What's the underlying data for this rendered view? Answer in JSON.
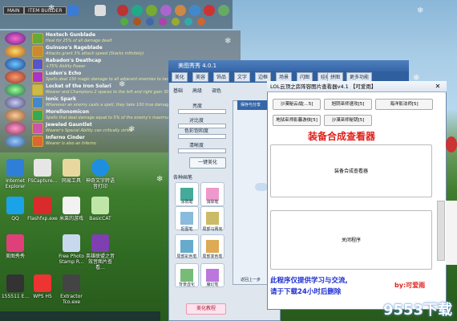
{
  "topbar": {
    "tab_main": "MAIN",
    "tab_builder": "ITEM BUILDER"
  },
  "items": [
    {
      "name": "Hextech Gunblade",
      "desc": "Heal for 25% of all damage dealt"
    },
    {
      "name": "Guinsoo's Rageblade",
      "desc": "Attacks grant 3% attack speed (Stacks infinitely)"
    },
    {
      "name": "Rabadon's Deathcap",
      "desc": "+75% Ability Power"
    },
    {
      "name": "Luden's Echo",
      "desc": "Spells deal 150 magic damage to all adjacent enemies to target"
    },
    {
      "name": "Locket of the Iron Solari",
      "desc": "Wearer and Champions 2 spaces to the left and right gain 300 shield on round start for 8 seconds"
    },
    {
      "name": "Ionic Spark",
      "desc": "Whenever an enemy casts a spell, they take 100 true damage"
    },
    {
      "name": "Morellonomicon",
      "desc": "Spells that deal damage equal to 5% of the enemy's maximum health per second and reduce healing by 80%"
    },
    {
      "name": "Jeweled Gauntlet",
      "desc": "Wearer's Special Ability can critically strike"
    },
    {
      "name": "Inferno Cinder",
      "desc": "Wearer is also an Inferno"
    }
  ],
  "desktop": [
    {
      "label": "Internet Explorer"
    },
    {
      "label": "FSCapture..."
    },
    {
      "label": "网易工具"
    },
    {
      "label": "神奇文字转语音打印"
    },
    {
      "label": "QQ"
    },
    {
      "label": "Flashfxp.exe"
    },
    {
      "label": "米莱的游戏"
    },
    {
      "label": "BasicCAT"
    },
    {
      "label": "美图秀秀"
    },
    {
      "label": "Free Photo Stamp R..."
    },
    {
      "label": "英雄联盟之音效音图片查看..."
    },
    {
      "label": "155511 E..."
    },
    {
      "label": "WPS H5"
    },
    {
      "label": "Extractor Tco.exe"
    }
  ],
  "meitu": {
    "title": "美图秀秀 4.0.1",
    "tabs": [
      "美化",
      "美容",
      "饰品",
      "文字",
      "边框",
      "场景",
      "闪图",
      "娃娃",
      "拼图",
      "更多功能"
    ],
    "subtabs": [
      "基础",
      "高级",
      "调色"
    ],
    "sliders": [
      "亮度",
      "对比度",
      "色彩饱和度",
      "清晰度"
    ],
    "one_click": "一键美化",
    "brush_section": "各种画笔",
    "brushes": [
      "涂鸦笔",
      "消除笔",
      "抠图笔",
      "局部马赛克",
      "局部彩色笔",
      "局部变色笔",
      "背景虚化",
      "魔幻笔"
    ],
    "bottom_button": "美化教程",
    "inner_label": "保存与分享",
    "inner_label2": "返回上一步"
  },
  "lol": {
    "title": "LOL云顶之弈阵容图片查看器v4.1 【可爱雨】",
    "buttons": [
      "沙漠秘云战[…5]",
      "旭阴巫师速攻[5]",
      "海洋影法师[5]",
      "地狱巫师影暮游侠[5]",
      "沙漠巫师秘钥[5]"
    ],
    "heading": "装备合成查看器",
    "big_button1": "装备合成查看器",
    "big_button2": "关闭程序",
    "notice1": "此程序仅提供学习与交流,",
    "notice2": "请于下载24小时后删除",
    "author": "by:可爱雨"
  },
  "watermark": "9553下载",
  "colors": {
    "notice": "#1e2fd0",
    "heading": "#e0201b",
    "author": "#e0201b"
  }
}
